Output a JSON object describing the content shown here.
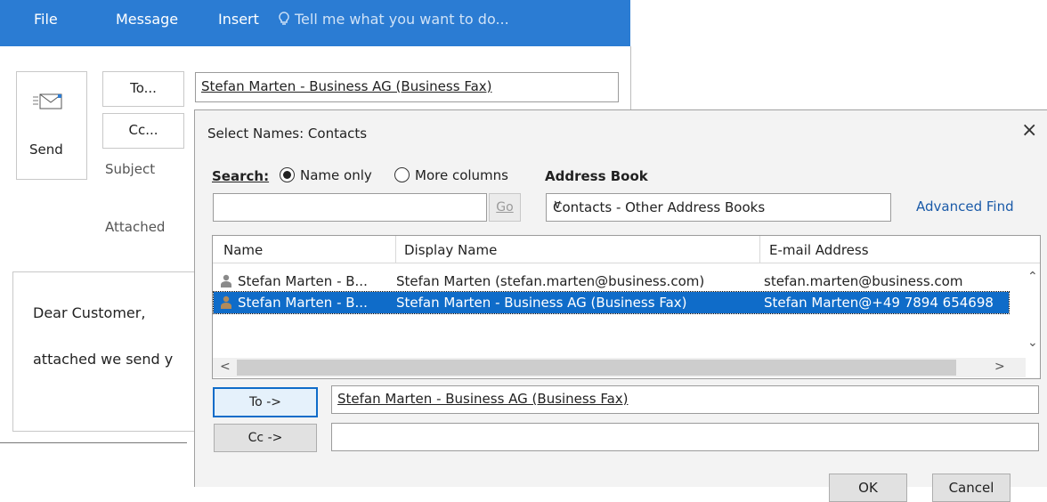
{
  "ribbon": {
    "tabs": [
      "File",
      "Message",
      "Insert"
    ],
    "tell_me": "Tell me what you want to do..."
  },
  "compose": {
    "send_label": "Send",
    "to_button": "To...",
    "cc_button": "Cc...",
    "subject_label": "Subject",
    "attached_label": "Attached",
    "to_value": "Stefan Marten - Business AG (Business Fax)",
    "body_lines": [
      "Dear Customer,",
      "attached we send y"
    ]
  },
  "dialog": {
    "title": "Select Names: Contacts",
    "close": "×",
    "search_label": "Search:",
    "radio_name_only": "Name only",
    "radio_more_columns": "More columns",
    "radio_selected": "Name only",
    "address_book_label": "Address Book",
    "search_value": "",
    "go_label": "Go",
    "address_book_value": "Contacts - Other Address Books",
    "advanced_find": "Advanced Find",
    "columns": [
      "Name",
      "Display Name",
      "E-mail Address"
    ],
    "rows": [
      {
        "name": "Stefan Marten - B...",
        "display": "Stefan Marten (stefan.marten@business.com)",
        "email": "stefan.marten@business.com",
        "selected": false
      },
      {
        "name": "Stefan Marten - B...",
        "display": "Stefan Marten - Business AG (Business Fax)",
        "email": "Stefan Marten@+49 7894 654698",
        "selected": true
      }
    ],
    "to_button": "To ->",
    "cc_button": "Cc ->",
    "to_value": "Stefan Marten - Business AG (Business Fax)",
    "cc_value": "",
    "ok": "OK",
    "cancel": "Cancel"
  },
  "colors": {
    "ribbon": "#2b7cd3",
    "selection": "#0f6cc9",
    "link": "#1a5aa8"
  }
}
